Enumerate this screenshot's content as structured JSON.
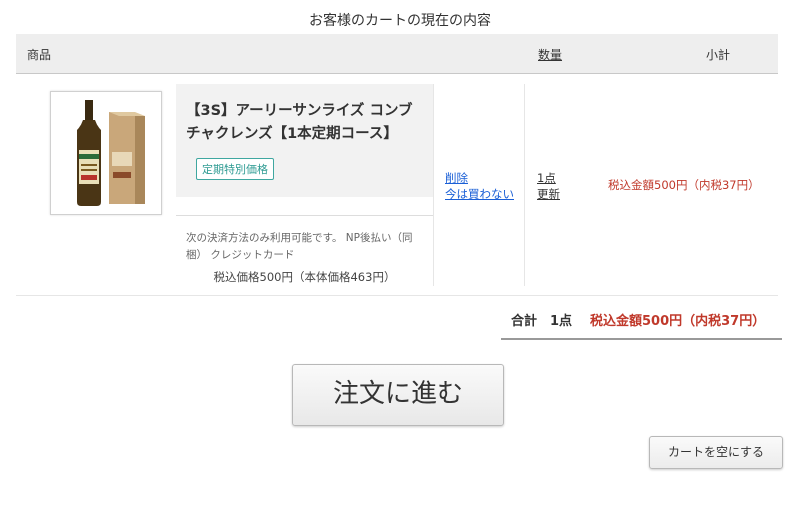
{
  "page": {
    "title": "お客様のカートの現在の内容"
  },
  "table_header": {
    "product": "商品",
    "quantity": "数量",
    "subtotal": "小計"
  },
  "cart_items": [
    {
      "name": "【3S】アーリーサンライズ コンブチャクレンズ【1本定期コース】",
      "badge": "定期特別価格",
      "payment_note": "次の決済方法のみ利用可能です。 NP後払い（同梱） クレジットカード",
      "price_note": "税込価格500円（本体価格463円）",
      "delete_link": "削除",
      "later_link": "今は買わない",
      "quantity": "1点",
      "update_link": "更新",
      "subtotal": "税込金額500円（内税37円）",
      "image": "kombucha-bottle-with-box"
    }
  ],
  "totals": {
    "label": "合計",
    "count": "1点",
    "amount": "税込金額500円（内税37円）"
  },
  "buttons": {
    "order": "注文に進む",
    "empty_cart": "カートを空にする"
  },
  "colors": {
    "price_red": "#c0392b",
    "badge_teal": "#3fa7a0",
    "link_blue": "#1a5fd6"
  }
}
